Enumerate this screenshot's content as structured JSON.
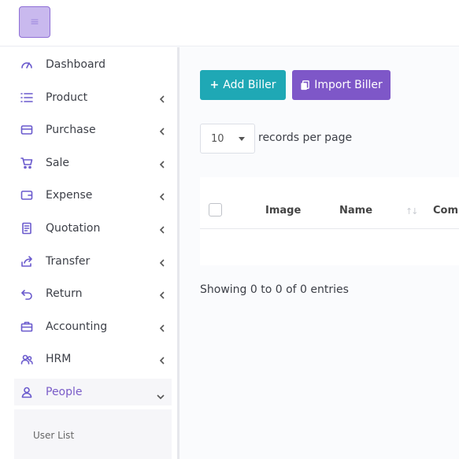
{
  "topbar": {
    "menu_icon": "hamburger-icon"
  },
  "sidebar": {
    "items": [
      {
        "label": "Dashboard",
        "icon": "speedometer-icon",
        "has_submenu": false
      },
      {
        "label": "Product",
        "icon": "list-icon",
        "has_submenu": true
      },
      {
        "label": "Purchase",
        "icon": "card-icon",
        "has_submenu": true
      },
      {
        "label": "Sale",
        "icon": "cart-icon",
        "has_submenu": true
      },
      {
        "label": "Expense",
        "icon": "wallet-icon",
        "has_submenu": true
      },
      {
        "label": "Quotation",
        "icon": "document-icon",
        "has_submenu": true
      },
      {
        "label": "Transfer",
        "icon": "share-icon",
        "has_submenu": true
      },
      {
        "label": "Return",
        "icon": "return-icon",
        "has_submenu": true
      },
      {
        "label": "Accounting",
        "icon": "briefcase-icon",
        "has_submenu": true
      },
      {
        "label": "HRM",
        "icon": "users-icon",
        "has_submenu": true
      },
      {
        "label": "People",
        "icon": "user-icon",
        "has_submenu": true,
        "expanded": true
      }
    ],
    "submenu": {
      "label": "User List"
    }
  },
  "main": {
    "add_button": "Add Biller",
    "import_button": "Import Biller",
    "per_page_value": "10",
    "per_page_label": "records per page",
    "columns": [
      "Image",
      "Name",
      "Comp"
    ],
    "info": "Showing 0 to 0 of 0 entries"
  },
  "colors": {
    "accent": "#7e57c8",
    "teal": "#1fa8b5"
  }
}
